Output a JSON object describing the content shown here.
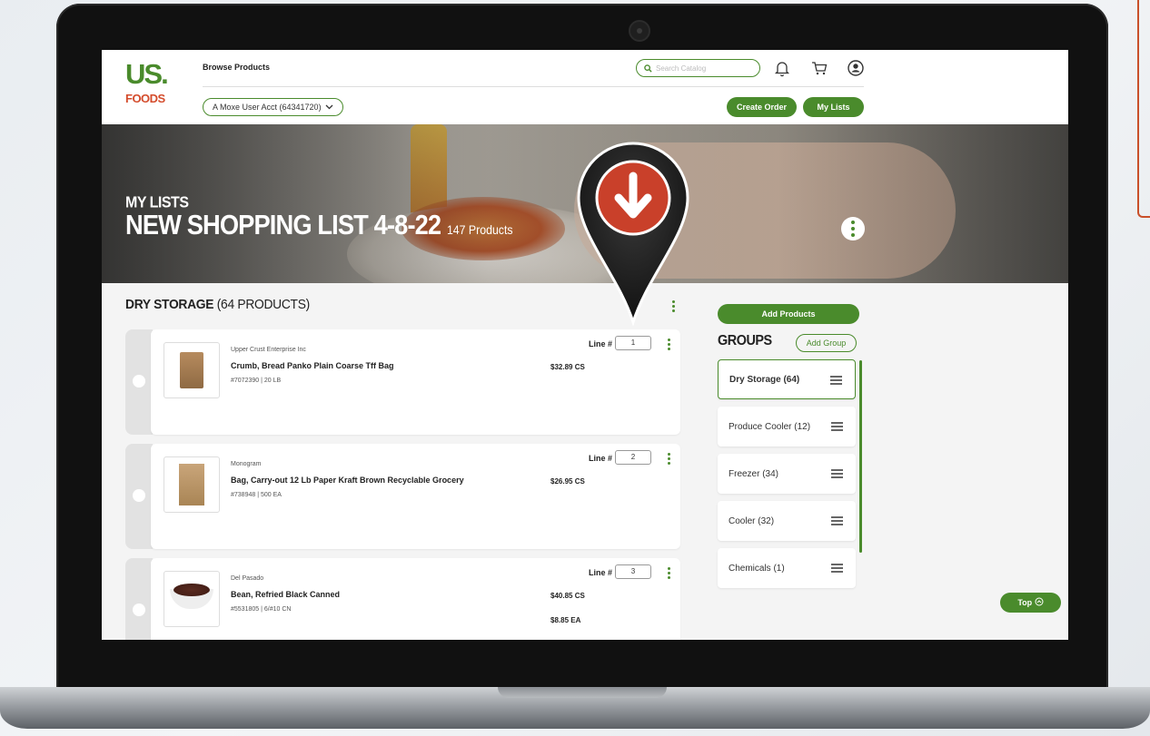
{
  "header": {
    "browse_label": "Browse Products",
    "account_label": "A Moxe User Acct (64341720)",
    "search_placeholder": "Search Catalog",
    "create_order_label": "Create Order",
    "my_lists_label": "My Lists"
  },
  "logo": {
    "line1": "US.",
    "line2": "FOODS"
  },
  "hero": {
    "kicker": "MY LISTS",
    "title": "NEW SHOPPING LIST 4-8-22",
    "count": "147 Products"
  },
  "section": {
    "name": "DRY STORAGE",
    "count": "(64 PRODUCTS)"
  },
  "products": [
    {
      "brand": "Upper Crust Enterprise Inc",
      "name": "Crumb, Bread Panko Plain Coarse Tff Bag",
      "meta": "#7072390  |  20 LB",
      "price": "$32.89 CS",
      "line_label": "Line #",
      "line": "1"
    },
    {
      "brand": "Monogram",
      "name": "Bag, Carry-out 12 Lb Paper Kraft Brown Recyclable Grocery",
      "meta": "#738948  |  500 EA",
      "price": "$26.95 CS",
      "line_label": "Line #",
      "line": "2"
    },
    {
      "brand": "Del Pasado",
      "name": "Bean, Refried Black Canned",
      "meta": "#5531805  |  6/#10 CN",
      "price": "$40.85 CS",
      "price2": "$8.85 EA",
      "line_label": "Line #",
      "line": "3"
    }
  ],
  "sidebar": {
    "add_products_label": "Add Products",
    "groups_title": "GROUPS",
    "add_group_label": "Add Group",
    "groups": [
      {
        "label": "Dry Storage (64)"
      },
      {
        "label": "Produce Cooler (12)"
      },
      {
        "label": "Freezer (34)"
      },
      {
        "label": "Cooler (32)"
      },
      {
        "label": "Chemicals (1)"
      }
    ]
  },
  "top_label": "Top",
  "colors": {
    "brand_green": "#4a8b2c",
    "brand_red": "#d44c2c",
    "pin_red": "#c9402a"
  },
  "icons": [
    "search-icon",
    "bell-icon",
    "cart-icon",
    "user-icon",
    "chevron-down-icon",
    "kebab-icon",
    "drag-handle-icon",
    "download-pin-icon",
    "chevron-up-circle-icon"
  ]
}
